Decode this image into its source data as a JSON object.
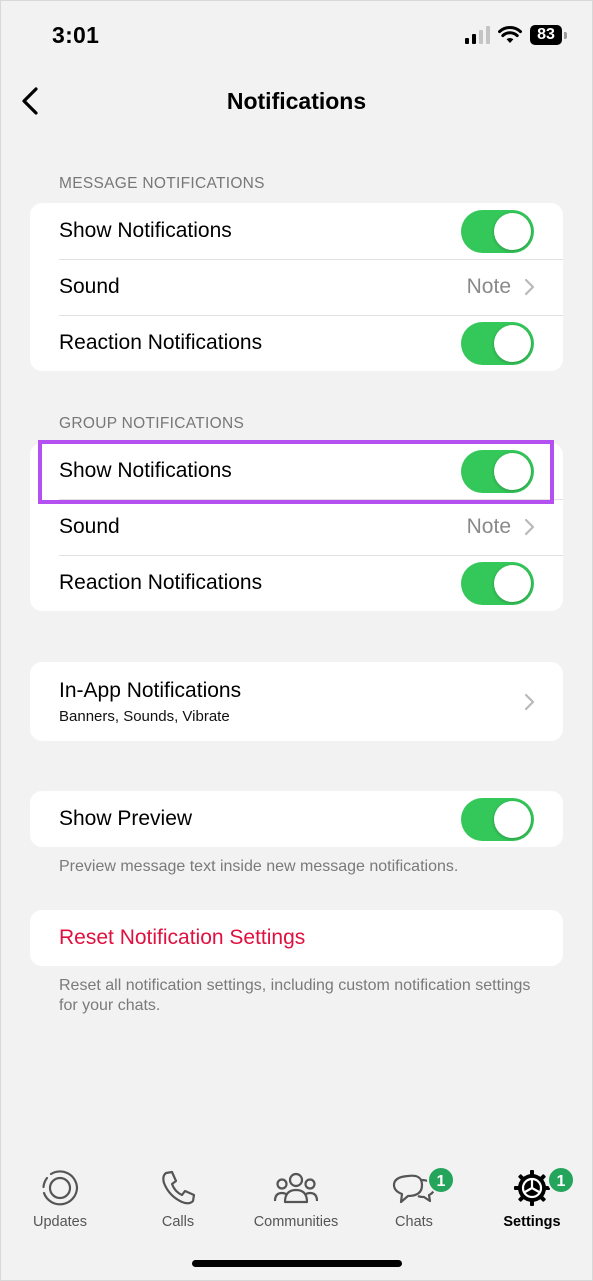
{
  "status_bar": {
    "time": "3:01",
    "battery": "83"
  },
  "nav": {
    "title": "Notifications"
  },
  "message_section": {
    "header": "MESSAGE NOTIFICATIONS",
    "show_notifications": "Show Notifications",
    "sound_label": "Sound",
    "sound_value": "Note",
    "reaction_notifications": "Reaction Notifications"
  },
  "group_section": {
    "header": "GROUP NOTIFICATIONS",
    "show_notifications": "Show Notifications",
    "sound_label": "Sound",
    "sound_value": "Note",
    "reaction_notifications": "Reaction Notifications"
  },
  "in_app": {
    "title": "In-App Notifications",
    "subtitle": "Banners, Sounds, Vibrate"
  },
  "preview": {
    "label": "Show Preview",
    "footer": "Preview message text inside new message notifications."
  },
  "reset": {
    "label": "Reset Notification Settings",
    "footer": "Reset all notification settings, including custom notification settings for your chats."
  },
  "tabs": [
    {
      "label": "Updates"
    },
    {
      "label": "Calls"
    },
    {
      "label": "Communities"
    },
    {
      "label": "Chats",
      "badge": "1"
    },
    {
      "label": "Settings",
      "badge": "1"
    }
  ],
  "colors": {
    "toggle_on": "#34c759",
    "destructive": "#e0103f",
    "badge": "#25a45c",
    "highlight": "#b44ff0"
  }
}
